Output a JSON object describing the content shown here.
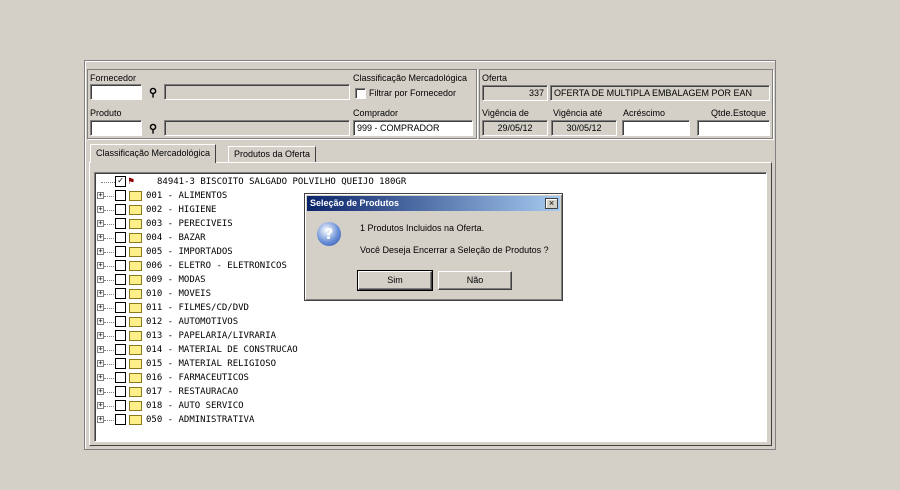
{
  "labels": {
    "fornecedor": "Fornecedor",
    "classificacao": "Classificação Mercadológica",
    "filtrar": "Filtrar por Fornecedor",
    "produto": "Produto",
    "comprador": "Comprador",
    "oferta": "Oferta",
    "vigencia_de": "Vigência de",
    "vigencia_ate": "Vigência até",
    "acrescimo": "Acréscimo",
    "qtde_estoque": "Qtde.Estoque"
  },
  "fields": {
    "fornecedor_code": "",
    "fornecedor_name": "",
    "produto_code": "",
    "produto_name": "",
    "comprador": "999 - COMPRADOR",
    "oferta_code": "337",
    "oferta_desc": "OFERTA DE MULTIPLA EMBALAGEM POR EAN",
    "vigencia_de": "29/05/12",
    "vigencia_ate": "30/05/12",
    "acrescimo": "",
    "qtde_estoque": ""
  },
  "tabs": [
    {
      "label": "Classificação Mercadológica"
    },
    {
      "label": "Produtos da Oferta"
    }
  ],
  "tree": {
    "root": "84941-3 BISCOITO SALGADO POLVILHO QUEIJO 180GR",
    "items": [
      "001 - ALIMENTOS",
      "002 - HIGIENE",
      "003 - PERECIVEIS",
      "004 - BAZAR",
      "005 - IMPORTADOS",
      "006 - ELETRO - ELETRONICOS",
      "009 - MODAS",
      "010 - MOVEIS",
      "011 - FILMES/CD/DVD",
      "012 - AUTOMOTIVOS",
      "013 - PAPELARIA/LIVRARIA",
      "014 - MATERIAL DE CONSTRUCAO",
      "015 - MATERIAL RELIGIOSO",
      "016 - FARMACEUTICOS",
      "017 - RESTAURACAO",
      "018 - AUTO SERVICO",
      "050 - ADMINISTRATIVA"
    ]
  },
  "dialog": {
    "title": "Seleção de Produtos",
    "close": "×",
    "icon": "question-icon",
    "line1": "1 Produtos Incluidos na Oferta.",
    "line2": "Você Deseja Encerrar a Seleção de Produtos ?",
    "yes": "Sim",
    "no": "Não"
  }
}
